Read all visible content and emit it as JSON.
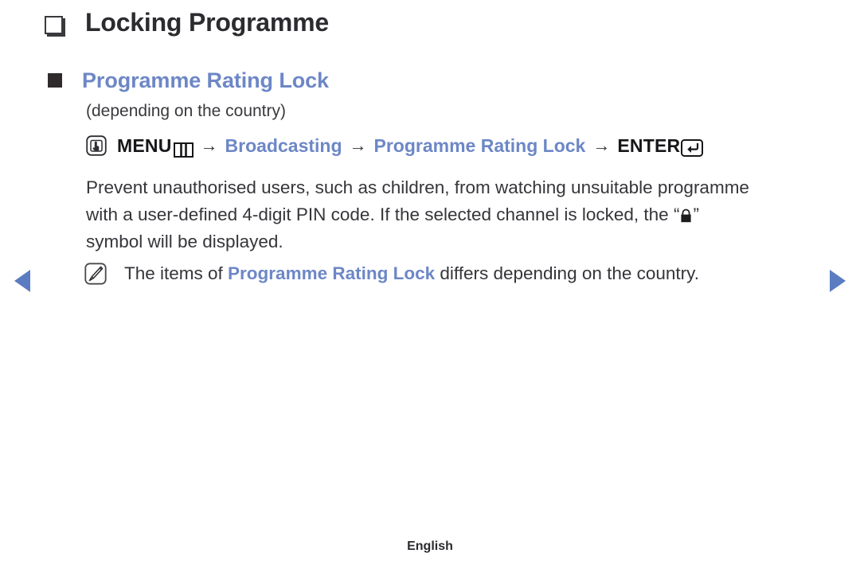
{
  "heading": {
    "bullet_icon": "square-outline-shadow-icon",
    "title": "Locking Programme"
  },
  "subheading": {
    "bullet_icon": "square-filled-icon",
    "title": "Programme Rating Lock",
    "note": "(depending on the country)"
  },
  "menu_path": {
    "press_icon": "hand-press-button-icon",
    "menu_label": "MENU",
    "menu_icon": "menu-bars-icon",
    "arrow1": "→",
    "broadcasting_label": "Broadcasting",
    "arrow2": "→",
    "rating_lock_label": "Programme Rating Lock",
    "arrow3": "→",
    "enter_label": "ENTER",
    "enter_icon": "enter-return-key-icon"
  },
  "body": {
    "line1": "Prevent unauthorised users, such as children, from watching unsuitable",
    "line2": "programme with a user-defined 4-digit PIN code. If the selected channel is",
    "line3_before": "locked, the “",
    "lock_icon": "padlock-icon",
    "line3_after": "” symbol will be displayed."
  },
  "note": {
    "icon": "note-pencil-icon",
    "text_before": "The items of ",
    "highlight": "Programme Rating Lock",
    "text_after": " differs depending on the country."
  },
  "navigation": {
    "prev_icon": "triangle-left-icon",
    "next_icon": "triangle-right-icon"
  },
  "footer": {
    "language": "English"
  },
  "colors": {
    "accent_blue": "#6d87c6",
    "nav_blue": "#5b7cc0",
    "text_dark": "#35353a"
  }
}
